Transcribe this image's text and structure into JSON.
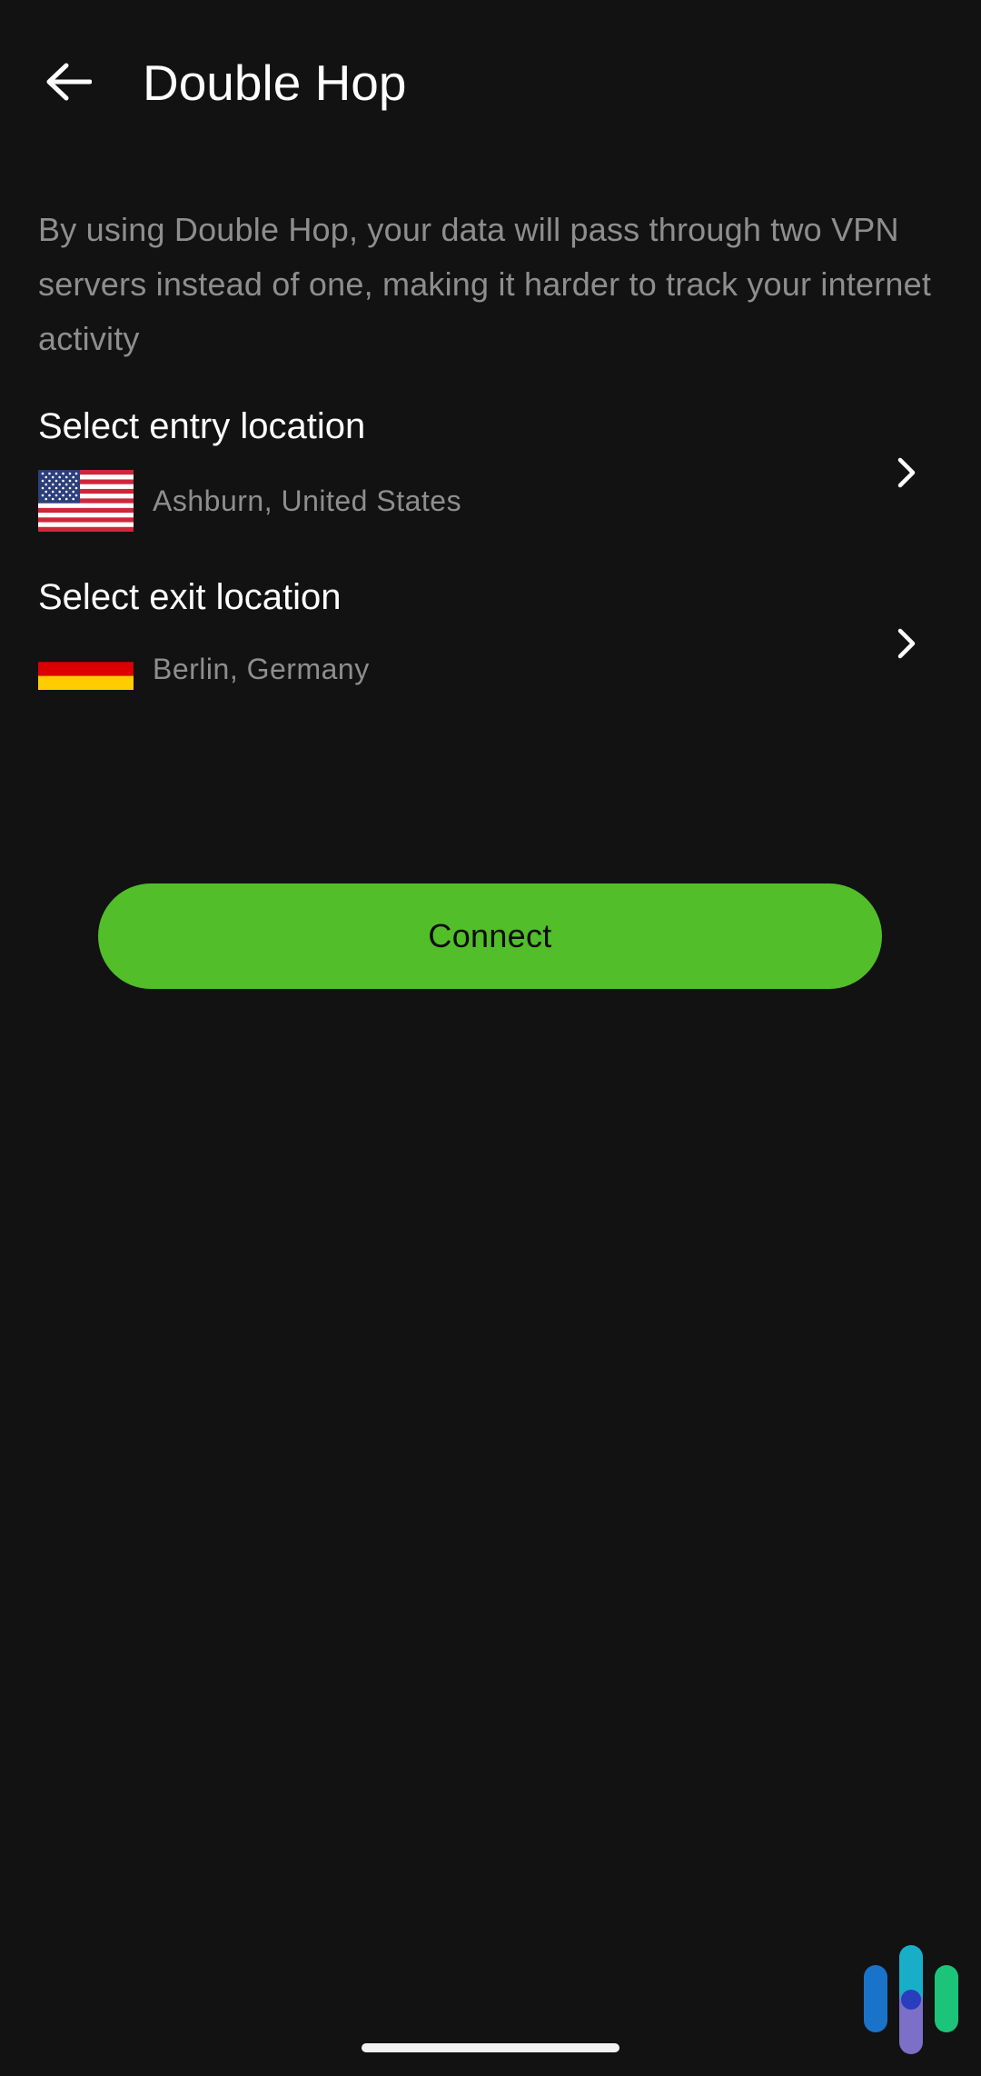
{
  "header": {
    "back_icon": "arrow-left-icon",
    "title": "Double Hop"
  },
  "description": "By using Double Hop, your data will pass through two VPN servers instead of one, making it harder to track your internet activity",
  "entry": {
    "label": "Select entry location",
    "flag_icon": "us-flag-icon",
    "value": "Ashburn, United States",
    "chevron_icon": "chevron-right-icon"
  },
  "exit": {
    "label": "Select exit location",
    "flag_icon": "germany-flag-icon",
    "value": "Berlin, Germany",
    "chevron_icon": "chevron-right-icon"
  },
  "connect_button": {
    "label": "Connect"
  },
  "colors": {
    "background": "#121212",
    "accent": "#52be2a",
    "secondary_text": "#8e8e8e",
    "primary_text": "#ffffff"
  }
}
